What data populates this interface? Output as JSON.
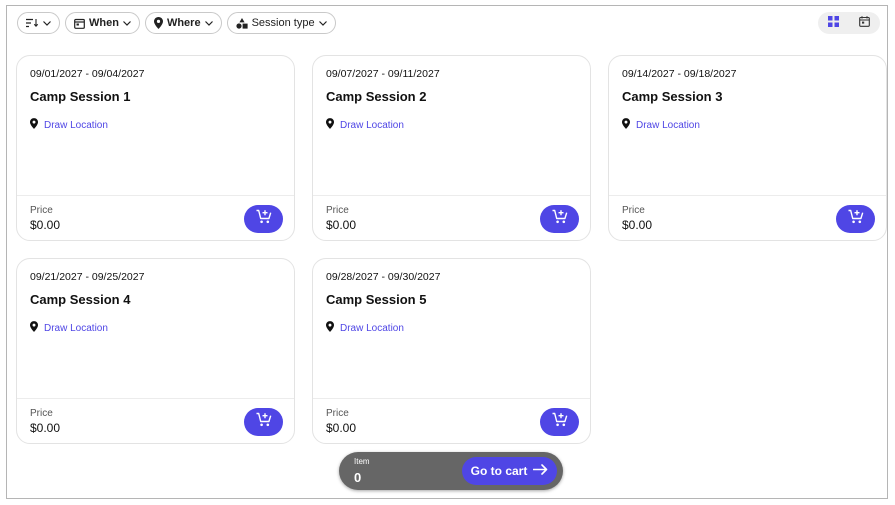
{
  "filters": {
    "sort_icon": "sort-icon",
    "when_label": "When",
    "where_label": "Where",
    "session_type_label": "Session type"
  },
  "view_toggle": {
    "active": "grid",
    "options": [
      "grid-view-icon",
      "calendar-view-icon"
    ]
  },
  "sessions": [
    {
      "dates": "09/01/2027 - 09/04/2027",
      "title": "Camp Session 1",
      "location_link": "Draw Location",
      "price_label": "Price",
      "price": "$0.00"
    },
    {
      "dates": "09/07/2027 - 09/11/2027",
      "title": "Camp Session 2",
      "location_link": "Draw Location",
      "price_label": "Price",
      "price": "$0.00"
    },
    {
      "dates": "09/14/2027 - 09/18/2027",
      "title": "Camp Session 3",
      "location_link": "Draw Location",
      "price_label": "Price",
      "price": "$0.00"
    },
    {
      "dates": "09/21/2027 - 09/25/2027",
      "title": "Camp Session 4",
      "location_link": "Draw Location",
      "price_label": "Price",
      "price": "$0.00"
    },
    {
      "dates": "09/28/2027 - 09/30/2027",
      "title": "Camp Session 5",
      "location_link": "Draw Location",
      "price_label": "Price",
      "price": "$0.00"
    }
  ],
  "cart_bar": {
    "item_label": "Item",
    "item_count": "0",
    "go_label": "Go to cart"
  },
  "colors": {
    "accent": "#4f46e5",
    "cart_bar_bg": "#666666"
  }
}
